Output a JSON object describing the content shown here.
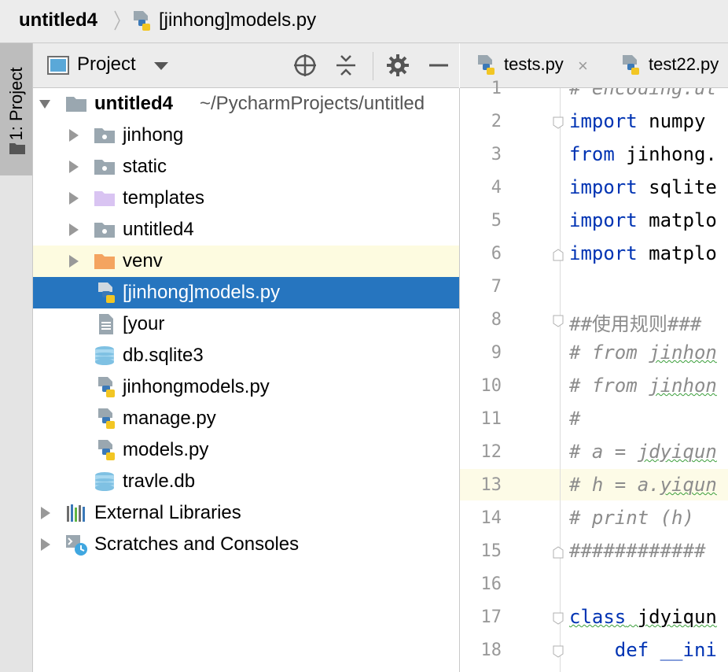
{
  "navbar": {
    "project": "untitled4",
    "file": "[jinhong]models.py"
  },
  "side_stripe": {
    "tab_label": "1: Project"
  },
  "project_panel": {
    "title": "Project",
    "tree": [
      {
        "label": "untitled4",
        "path": "~/PycharmProjects/untitled",
        "kind": "root-folder",
        "expanded": true
      },
      {
        "label": "jinhong",
        "kind": "package-folder"
      },
      {
        "label": "static",
        "kind": "package-folder"
      },
      {
        "label": "templates",
        "kind": "templates-folder"
      },
      {
        "label": "untitled4",
        "kind": "package-folder"
      },
      {
        "label": "venv",
        "kind": "excluded-folder"
      },
      {
        "label": "[jinhong]models.py",
        "kind": "python-file",
        "selected": true
      },
      {
        "label": "[your",
        "kind": "text-file"
      },
      {
        "label": "db.sqlite3",
        "kind": "database-file"
      },
      {
        "label": "jinhongmodels.py",
        "kind": "python-file"
      },
      {
        "label": "manage.py",
        "kind": "python-file"
      },
      {
        "label": "models.py",
        "kind": "python-file"
      },
      {
        "label": "travle.db",
        "kind": "database-file"
      },
      {
        "label": "External Libraries",
        "kind": "libraries"
      },
      {
        "label": "Scratches and Consoles",
        "kind": "scratches"
      }
    ]
  },
  "editor": {
    "tabs": [
      {
        "label": "tests.py",
        "close": "×"
      },
      {
        "label": "test22.py"
      }
    ],
    "line_numbers": [
      "1",
      "2",
      "3",
      "4",
      "5",
      "6",
      "7",
      "8",
      "9",
      "10",
      "11",
      "12",
      "13",
      "14",
      "15",
      "16",
      "17",
      "18"
    ],
    "current_line": "13",
    "code_lines": [
      {
        "text": "# encoding:ut"
      },
      {
        "kw": "import",
        "rest": " numpy"
      },
      {
        "kw": "from",
        "rest": " jinhong."
      },
      {
        "kw": "import",
        "rest": " sqlite"
      },
      {
        "kw": "import",
        "rest": " matplo"
      },
      {
        "kw": "import",
        "rest": " matplo"
      },
      {
        "text": ""
      },
      {
        "text": "##使用规则###"
      },
      {
        "pre": "# from ",
        "wavy": "jinhon"
      },
      {
        "pre": "# from ",
        "wavy": "jinhon"
      },
      {
        "text": "#"
      },
      {
        "pre": "# a = ",
        "wavy": "jdyiqun"
      },
      {
        "pre": "# h = a.",
        "wavy": "yiqun"
      },
      {
        "text": "# print (h)"
      },
      {
        "text": "############"
      },
      {
        "text": ""
      },
      {
        "kw": "class",
        "rest": " jdyiqun"
      },
      {
        "kw": "    def",
        "rest": " __ini"
      }
    ]
  },
  "colors": {
    "selection": "#2675bf",
    "keyword": "#0033b3",
    "comment": "#8c8c8c",
    "venv_highlight": "#fdfbe0",
    "current_line": "#fdfbe7"
  }
}
